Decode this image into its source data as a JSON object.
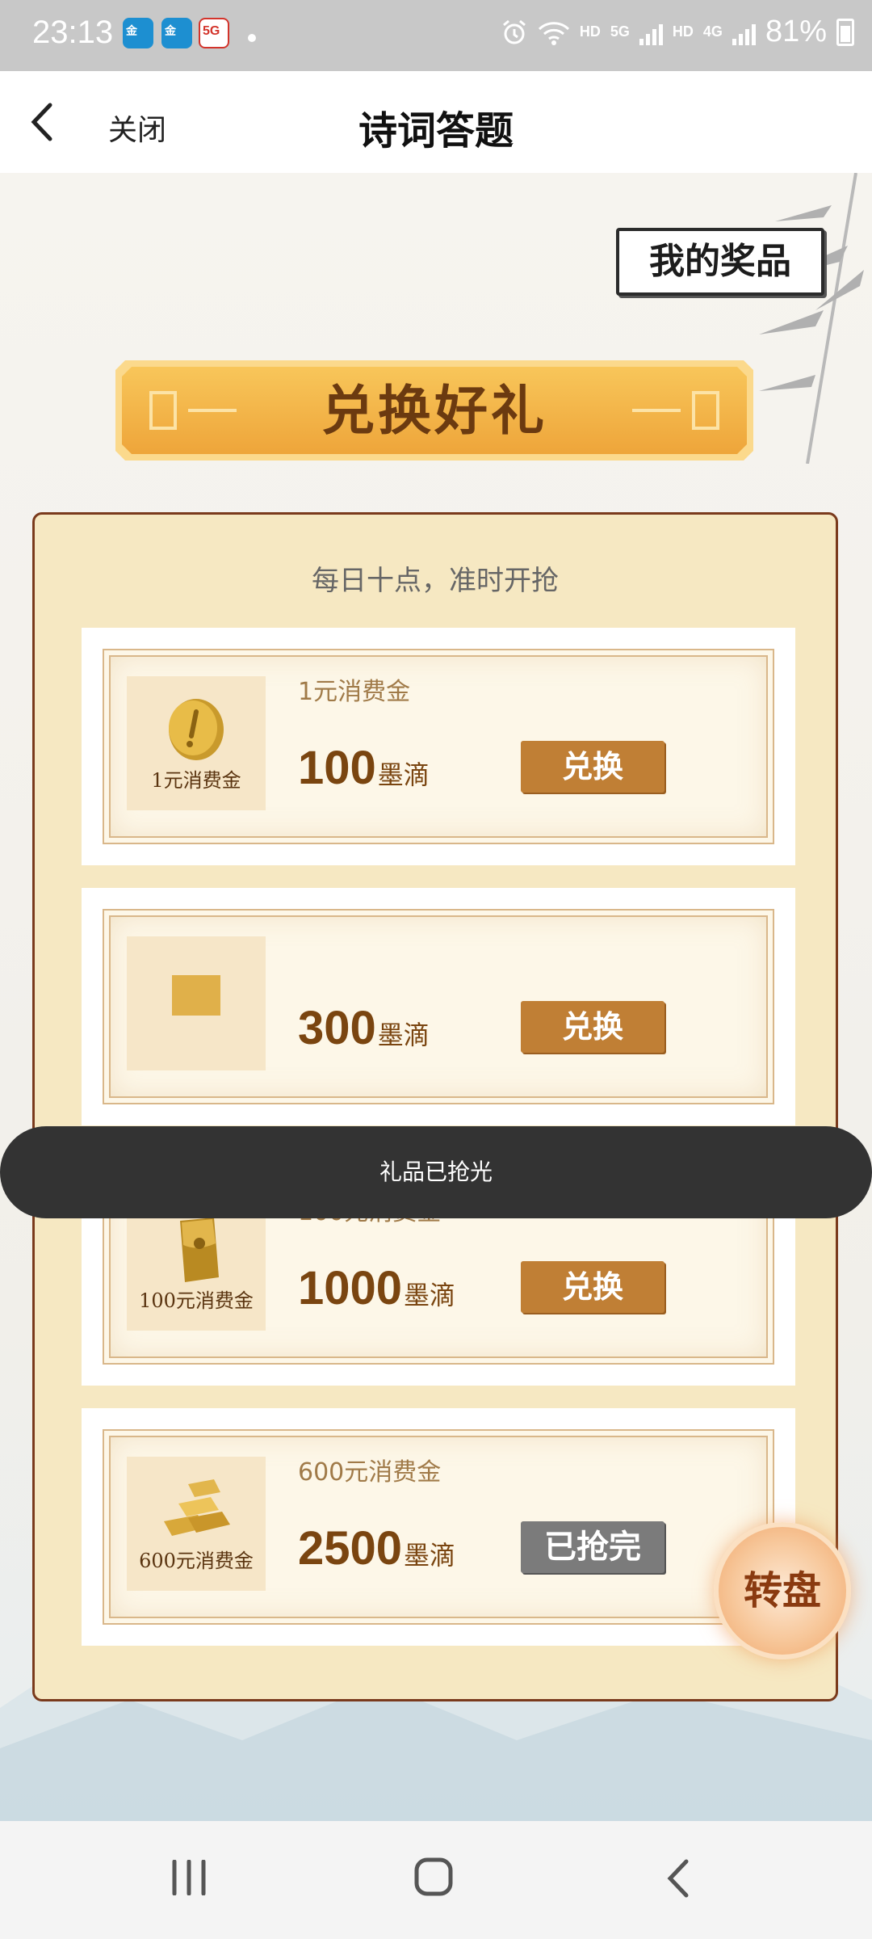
{
  "status_bar": {
    "time": "23:13",
    "battery": "81%",
    "network_left": "HD",
    "network_right": "HD",
    "sig1": "5G",
    "sig2": "4G",
    "app3_label": "5G"
  },
  "header": {
    "close_label": "关闭",
    "title": "诗词答题"
  },
  "main": {
    "my_prizes_label": "我的奖品",
    "banner_title": "兑换好礼",
    "subtitle": "每日十点，准时开抢",
    "unit": "墨滴",
    "cards": [
      {
        "thumb_label": "1元消费金",
        "name": "1元消费金",
        "price": "100",
        "button": "兑换",
        "icon": "gold-coin-icon"
      },
      {
        "thumb_label": "",
        "name": "",
        "price": "300",
        "button": "兑换",
        "icon": "gift-icon"
      },
      {
        "thumb_label": "100元消费金",
        "name": "100元消费金",
        "price": "1000",
        "button": "兑换",
        "icon": "red-packet-icon"
      },
      {
        "thumb_label": "600元消费金",
        "name": "600元消费金",
        "price": "2500",
        "button": "已抢完",
        "icon": "gold-bars-icon"
      }
    ],
    "toast": "礼品已抢光",
    "wheel_label": "转盘"
  },
  "colors": {
    "accent": "#c07f35",
    "panel_bg": "#f6e8c2",
    "panel_border": "#7a3a1c",
    "price_text": "#7a4510"
  }
}
